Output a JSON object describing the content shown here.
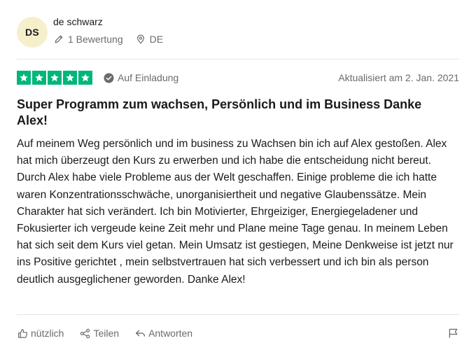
{
  "reviewer": {
    "initials": "DS",
    "name": "de schwarz",
    "reviews_count": "1 Bewertung",
    "country": "DE",
    "avatar_color": "#f6efcc"
  },
  "review": {
    "stars": 5,
    "star_color": "#00b67a",
    "invited_label": "Auf Einladung",
    "date_label": "Aktualisiert am 2. Jan. 2021",
    "title": "Super Programm zum wachsen, Persönlich und im Business Danke Alex!",
    "body": "Auf meinem Weg persönlich und im business zu Wachsen bin ich auf Alex gestoßen. Alex hat mich überzeugt den Kurs zu erwerben und ich habe die entscheidung nicht bereut. Durch Alex habe viele Probleme aus der Welt geschaffen. Einige probleme die ich hatte waren Konzentrationsschwäche, unorganisiertheit und negative Glaubenssätze. Mein Charakter hat sich verändert. Ich bin Motivierter, Ehrgeiziger, Energiegeladener und Fokusierter ich vergeude keine Zeit mehr und Plane meine Tage genau. In meinem Leben hat sich seit dem Kurs viel getan. Mein Umsatz ist gestiegen, Meine Denkweise ist jetzt nur ins Positive gerichtet , mein selbstvertrauen hat sich verbessert und ich bin als person deutlich ausgeglichener geworden. Danke Alex!"
  },
  "actions": {
    "useful_label": "nützlich",
    "share_label": "Teilen",
    "reply_label": "Antworten"
  },
  "icons": {
    "reviews": "pencil-icon",
    "country": "location-pin-icon",
    "invited": "check-circle-icon",
    "useful": "thumbs-up-icon",
    "share": "share-icon",
    "reply": "reply-icon",
    "report": "flag-icon"
  }
}
